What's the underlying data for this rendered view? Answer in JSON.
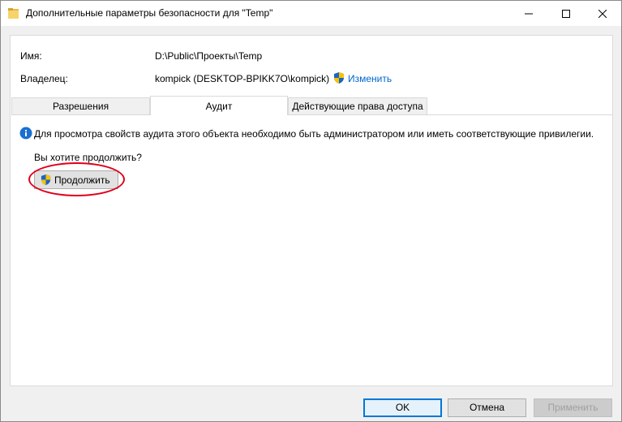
{
  "window": {
    "title": "Дополнительные параметры безопасности  для \"Temp\""
  },
  "info": {
    "name_label": "Имя:",
    "name_value": "D:\\Public\\Проекты\\Temp",
    "owner_label": "Владелец:",
    "owner_value": "kompick (DESKTOP-BPIKK7O\\kompick)",
    "change_link": "Изменить"
  },
  "tabs": [
    {
      "label": "Разрешения",
      "selected": false
    },
    {
      "label": "Аудит",
      "selected": true
    },
    {
      "label": "Действующие права доступа",
      "selected": false
    }
  ],
  "audit": {
    "message": "Для просмотра свойств аудита этого объекта необходимо быть администратором или иметь соответствующие привилегии.",
    "question": "Вы хотите продолжить?",
    "continue_button": "Продолжить",
    "highlight_color": "#e0001b"
  },
  "buttons": {
    "ok": "OK",
    "cancel": "Отмена",
    "apply": "Применить"
  },
  "icons": {
    "title": "folder-icon",
    "owner": "uac-shield-icon",
    "info": "info-icon",
    "continue": "uac-shield-icon"
  },
  "colors": {
    "link": "#0066cc",
    "default_button_border": "#0078d7"
  }
}
